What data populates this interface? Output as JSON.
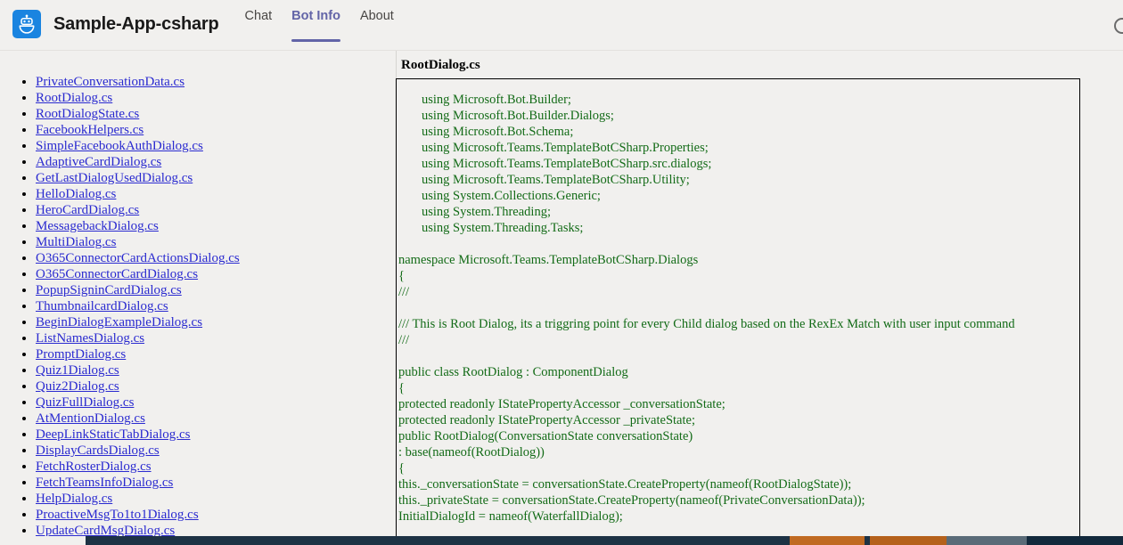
{
  "header": {
    "logo_icon": "bot-icon",
    "title": "Sample-App-csharp",
    "tabs": [
      {
        "label": "Chat",
        "active": false
      },
      {
        "label": "Bot Info",
        "active": true
      },
      {
        "label": "About",
        "active": false
      }
    ],
    "accent_color": "#6264a7",
    "logo_bg_color": "#1a84e0"
  },
  "sidebar": {
    "link_color": "#2a2ad0",
    "files": [
      "PrivateConversationData.cs",
      "RootDialog.cs",
      "RootDialogState.cs",
      "FacebookHelpers.cs",
      "SimpleFacebookAuthDialog.cs",
      "AdaptiveCardDialog.cs",
      "GetLastDialogUsedDialog.cs",
      "HelloDialog.cs",
      "HeroCardDialog.cs",
      "MessagebackDialog.cs",
      "MultiDialog.cs",
      "O365ConnectorCardActionsDialog.cs",
      "O365ConnectorCardDialog.cs",
      "PopupSigninCardDialog.cs",
      "ThumbnailcardDialog.cs",
      "BeginDialogExampleDialog.cs",
      "ListNamesDialog.cs",
      "PromptDialog.cs",
      "Quiz1Dialog.cs",
      "Quiz2Dialog.cs",
      "QuizFullDialog.cs",
      "AtMentionDialog.cs",
      "DeepLinkStaticTabDialog.cs",
      "DisplayCardsDialog.cs",
      "FetchRosterDialog.cs",
      "FetchTeamsInfoDialog.cs",
      "HelpDialog.cs",
      "ProactiveMsgTo1to1Dialog.cs",
      "UpdateCardMsgDialog.cs"
    ]
  },
  "code_panel": {
    "title": "RootDialog.cs",
    "code_color": "#136b17",
    "lines": [
      {
        "text": "using Microsoft.Bot.Builder;",
        "indent": 1
      },
      {
        "text": "using Microsoft.Bot.Builder.Dialogs;",
        "indent": 1
      },
      {
        "text": "using Microsoft.Bot.Schema;",
        "indent": 1
      },
      {
        "text": "using Microsoft.Teams.TemplateBotCSharp.Properties;",
        "indent": 1
      },
      {
        "text": "using Microsoft.Teams.TemplateBotCSharp.src.dialogs;",
        "indent": 1
      },
      {
        "text": "using Microsoft.Teams.TemplateBotCSharp.Utility;",
        "indent": 1
      },
      {
        "text": "using System.Collections.Generic;",
        "indent": 1
      },
      {
        "text": "using System.Threading;",
        "indent": 1
      },
      {
        "text": "using System.Threading.Tasks;",
        "indent": 1
      },
      {
        "text": "",
        "indent": 1
      },
      {
        "text": "namespace Microsoft.Teams.TemplateBotCSharp.Dialogs",
        "indent": 0
      },
      {
        "text": "{",
        "indent": 0
      },
      {
        "text": "///",
        "indent": 0
      },
      {
        "text": "",
        "indent": 0
      },
      {
        "text": "/// This is Root Dialog, its a triggring point for every Child dialog based on the RexEx Match with user input command",
        "indent": 0
      },
      {
        "text": "///",
        "indent": 0
      },
      {
        "text": "",
        "indent": 0
      },
      {
        "text": "public class RootDialog : ComponentDialog",
        "indent": 0
      },
      {
        "text": "{",
        "indent": 0
      },
      {
        "text": "protected readonly IStatePropertyAccessor _conversationState;",
        "indent": 0
      },
      {
        "text": "protected readonly IStatePropertyAccessor _privateState;",
        "indent": 0
      },
      {
        "text": "public RootDialog(ConversationState conversationState)",
        "indent": 0
      },
      {
        "text": ": base(nameof(RootDialog))",
        "indent": 0
      },
      {
        "text": "{",
        "indent": 0
      },
      {
        "text": "this._conversationState = conversationState.CreateProperty(nameof(RootDialogState));",
        "indent": 0
      },
      {
        "text": "this._privateState = conversationState.CreateProperty(nameof(PrivateConversationData));",
        "indent": 0
      },
      {
        "text": "InitialDialogId = nameof(WaterfallDialog);",
        "indent": 0
      }
    ]
  },
  "taskbar": {
    "background_color": "#1d3244",
    "accent_colors": [
      "#c06a22",
      "#b5611b",
      "#5a6b78"
    ]
  }
}
